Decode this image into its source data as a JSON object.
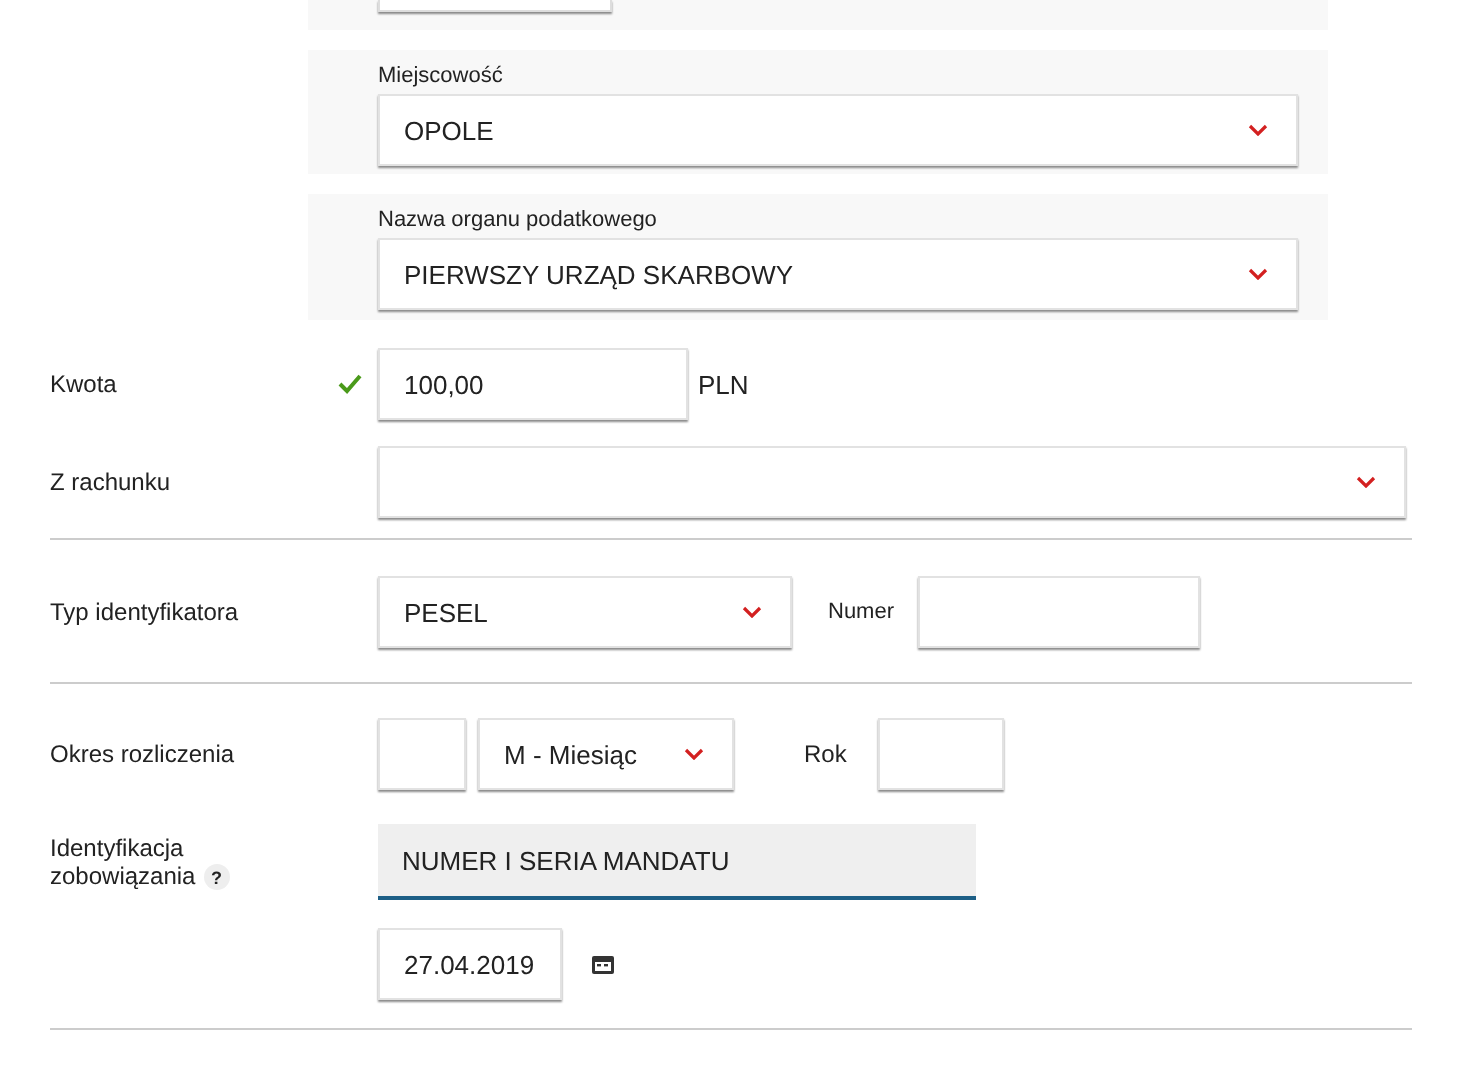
{
  "address_panels": [
    {
      "label": "Miejscowość",
      "value": "OPOLE"
    },
    {
      "label": "Nazwa organu podatkowego",
      "value": "PIERWSZY URZĄD SKARBOWY"
    }
  ],
  "amount": {
    "label": "Kwota",
    "valid": true,
    "value": "100,00",
    "currency": "PLN"
  },
  "account": {
    "label": "Z rachunku"
  },
  "identifier": {
    "label": "Typ identyfikatora",
    "type": "PESEL",
    "number_label": "Numer"
  },
  "period": {
    "label": "Okres rozliczenia",
    "period_type": "M - Miesiąc",
    "year_label": "Rok"
  },
  "obligation": {
    "label_lines": [
      "Identyfikacja",
      "zobowiązania"
    ],
    "help": "?",
    "value": "NUMER I SERIA MANDATU",
    "date": "27.04.2019"
  }
}
